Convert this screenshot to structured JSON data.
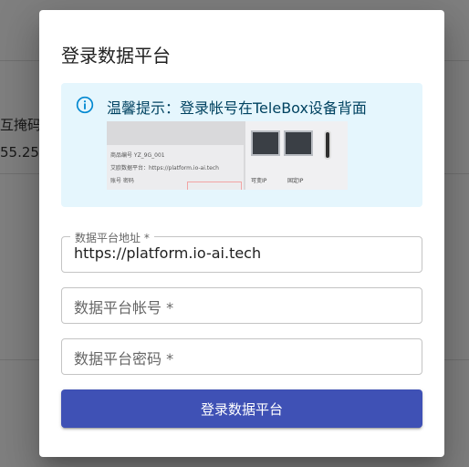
{
  "background": {
    "text_1": "互掩码",
    "text_2": "55.25"
  },
  "dialog": {
    "title": "登录数据平台",
    "info": {
      "text": "温馨提示：登录帐号在TeleBox设备背面",
      "icon": "info-icon"
    },
    "device_image": {
      "line_1": "商品编号   YZ_9G_001",
      "line_2": "艾欧数据平台：https://platform.io-ai.tech",
      "line_3": "账号                    密码",
      "port_label_1": "可变IP",
      "port_label_2": "固定IP"
    },
    "fields": {
      "address": {
        "label": "数据平台地址 *",
        "value": "https://platform.io-ai.tech"
      },
      "account": {
        "placeholder": "数据平台帐号 *"
      },
      "password": {
        "placeholder": "数据平台密码 *"
      }
    },
    "submit_label": "登录数据平台"
  },
  "colors": {
    "primary": "#3f51b5",
    "info_bg": "#e5f6fd",
    "info_text": "#014361"
  }
}
